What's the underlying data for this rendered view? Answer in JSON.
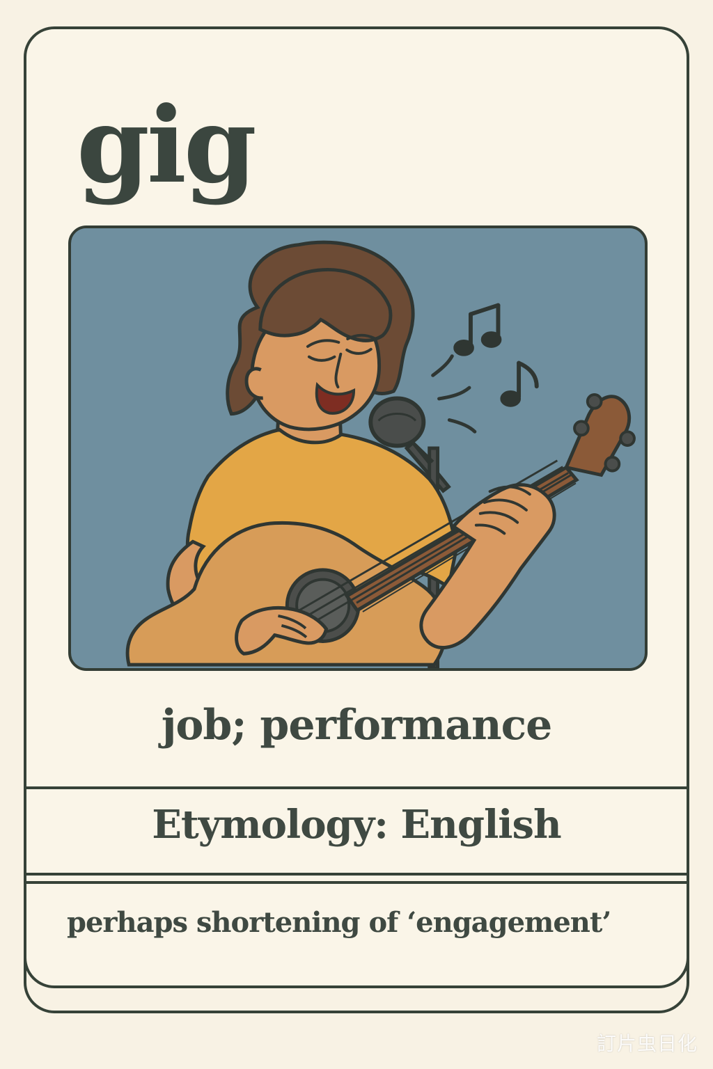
{
  "card": {
    "word": "gig",
    "meaning": "job; performance",
    "etymology": "Etymology: English",
    "origin_note": "perhaps shortening of ‘engagement’"
  },
  "illustration": {
    "subject": "singer-guitarist-icon"
  },
  "watermark": {
    "text": "訂片虫日化"
  },
  "colors": {
    "card_bg": "#faf5e8",
    "outline": "#364238",
    "panel_bg": "#6f8f9f",
    "shirt": "#e3a646",
    "skin": "#d99a62",
    "hair": "#6c4b35",
    "guitar": "#d79c58",
    "mic": "#4a4d4b"
  }
}
